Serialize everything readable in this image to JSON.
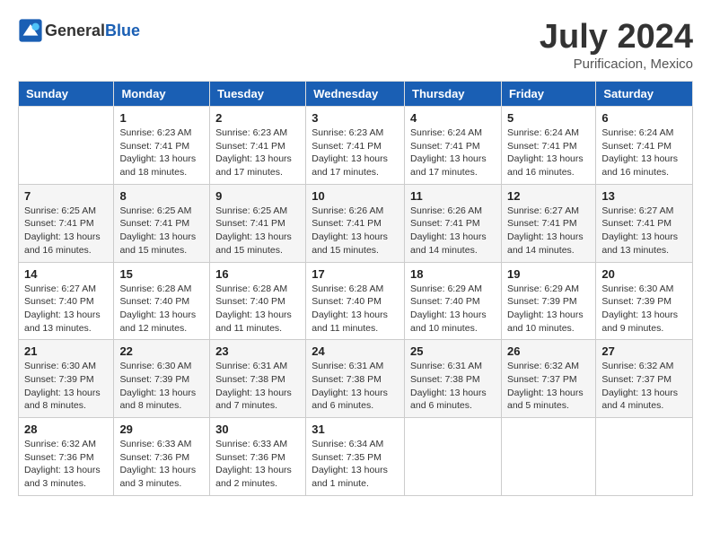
{
  "header": {
    "logo_general": "General",
    "logo_blue": "Blue",
    "month_title": "July 2024",
    "location": "Purificacion, Mexico"
  },
  "days_of_week": [
    "Sunday",
    "Monday",
    "Tuesday",
    "Wednesday",
    "Thursday",
    "Friday",
    "Saturday"
  ],
  "weeks": [
    [
      {
        "day": "",
        "info": ""
      },
      {
        "day": "1",
        "info": "Sunrise: 6:23 AM\nSunset: 7:41 PM\nDaylight: 13 hours\nand 18 minutes."
      },
      {
        "day": "2",
        "info": "Sunrise: 6:23 AM\nSunset: 7:41 PM\nDaylight: 13 hours\nand 17 minutes."
      },
      {
        "day": "3",
        "info": "Sunrise: 6:23 AM\nSunset: 7:41 PM\nDaylight: 13 hours\nand 17 minutes."
      },
      {
        "day": "4",
        "info": "Sunrise: 6:24 AM\nSunset: 7:41 PM\nDaylight: 13 hours\nand 17 minutes."
      },
      {
        "day": "5",
        "info": "Sunrise: 6:24 AM\nSunset: 7:41 PM\nDaylight: 13 hours\nand 16 minutes."
      },
      {
        "day": "6",
        "info": "Sunrise: 6:24 AM\nSunset: 7:41 PM\nDaylight: 13 hours\nand 16 minutes."
      }
    ],
    [
      {
        "day": "7",
        "info": "Sunrise: 6:25 AM\nSunset: 7:41 PM\nDaylight: 13 hours\nand 16 minutes."
      },
      {
        "day": "8",
        "info": "Sunrise: 6:25 AM\nSunset: 7:41 PM\nDaylight: 13 hours\nand 15 minutes."
      },
      {
        "day": "9",
        "info": "Sunrise: 6:25 AM\nSunset: 7:41 PM\nDaylight: 13 hours\nand 15 minutes."
      },
      {
        "day": "10",
        "info": "Sunrise: 6:26 AM\nSunset: 7:41 PM\nDaylight: 13 hours\nand 15 minutes."
      },
      {
        "day": "11",
        "info": "Sunrise: 6:26 AM\nSunset: 7:41 PM\nDaylight: 13 hours\nand 14 minutes."
      },
      {
        "day": "12",
        "info": "Sunrise: 6:27 AM\nSunset: 7:41 PM\nDaylight: 13 hours\nand 14 minutes."
      },
      {
        "day": "13",
        "info": "Sunrise: 6:27 AM\nSunset: 7:41 PM\nDaylight: 13 hours\nand 13 minutes."
      }
    ],
    [
      {
        "day": "14",
        "info": "Sunrise: 6:27 AM\nSunset: 7:40 PM\nDaylight: 13 hours\nand 13 minutes."
      },
      {
        "day": "15",
        "info": "Sunrise: 6:28 AM\nSunset: 7:40 PM\nDaylight: 13 hours\nand 12 minutes."
      },
      {
        "day": "16",
        "info": "Sunrise: 6:28 AM\nSunset: 7:40 PM\nDaylight: 13 hours\nand 11 minutes."
      },
      {
        "day": "17",
        "info": "Sunrise: 6:28 AM\nSunset: 7:40 PM\nDaylight: 13 hours\nand 11 minutes."
      },
      {
        "day": "18",
        "info": "Sunrise: 6:29 AM\nSunset: 7:40 PM\nDaylight: 13 hours\nand 10 minutes."
      },
      {
        "day": "19",
        "info": "Sunrise: 6:29 AM\nSunset: 7:39 PM\nDaylight: 13 hours\nand 10 minutes."
      },
      {
        "day": "20",
        "info": "Sunrise: 6:30 AM\nSunset: 7:39 PM\nDaylight: 13 hours\nand 9 minutes."
      }
    ],
    [
      {
        "day": "21",
        "info": "Sunrise: 6:30 AM\nSunset: 7:39 PM\nDaylight: 13 hours\nand 8 minutes."
      },
      {
        "day": "22",
        "info": "Sunrise: 6:30 AM\nSunset: 7:39 PM\nDaylight: 13 hours\nand 8 minutes."
      },
      {
        "day": "23",
        "info": "Sunrise: 6:31 AM\nSunset: 7:38 PM\nDaylight: 13 hours\nand 7 minutes."
      },
      {
        "day": "24",
        "info": "Sunrise: 6:31 AM\nSunset: 7:38 PM\nDaylight: 13 hours\nand 6 minutes."
      },
      {
        "day": "25",
        "info": "Sunrise: 6:31 AM\nSunset: 7:38 PM\nDaylight: 13 hours\nand 6 minutes."
      },
      {
        "day": "26",
        "info": "Sunrise: 6:32 AM\nSunset: 7:37 PM\nDaylight: 13 hours\nand 5 minutes."
      },
      {
        "day": "27",
        "info": "Sunrise: 6:32 AM\nSunset: 7:37 PM\nDaylight: 13 hours\nand 4 minutes."
      }
    ],
    [
      {
        "day": "28",
        "info": "Sunrise: 6:32 AM\nSunset: 7:36 PM\nDaylight: 13 hours\nand 3 minutes."
      },
      {
        "day": "29",
        "info": "Sunrise: 6:33 AM\nSunset: 7:36 PM\nDaylight: 13 hours\nand 3 minutes."
      },
      {
        "day": "30",
        "info": "Sunrise: 6:33 AM\nSunset: 7:36 PM\nDaylight: 13 hours\nand 2 minutes."
      },
      {
        "day": "31",
        "info": "Sunrise: 6:34 AM\nSunset: 7:35 PM\nDaylight: 13 hours\nand 1 minute."
      },
      {
        "day": "",
        "info": ""
      },
      {
        "day": "",
        "info": ""
      },
      {
        "day": "",
        "info": ""
      }
    ]
  ]
}
